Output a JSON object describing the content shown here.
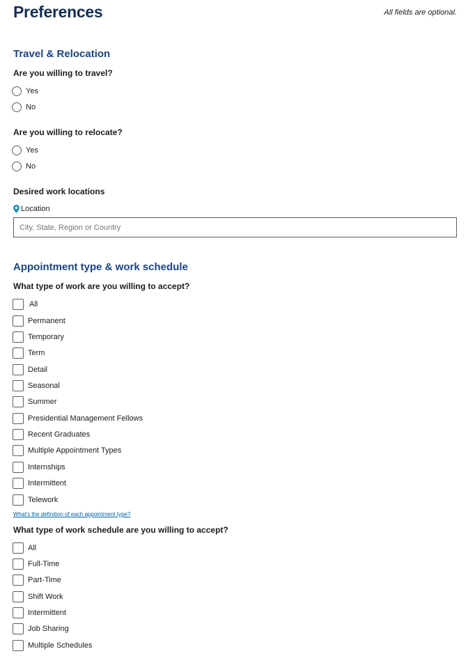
{
  "header": {
    "title": "Preferences",
    "optional_note": "All fields are optional."
  },
  "travel_relocation": {
    "section_title": "Travel & Relocation",
    "travel": {
      "question": "Are you willing to travel?",
      "options": [
        "Yes",
        "No"
      ],
      "selected": null
    },
    "relocate": {
      "question": "Are you willing to relocate?",
      "options": [
        "Yes",
        "No"
      ],
      "selected": null
    },
    "locations": {
      "question": "Desired work locations",
      "field_label": "Location",
      "field_icon": "map-pin-icon",
      "value": "",
      "placeholder": "City, State, Region or Country",
      "icon_color": "#2491bf"
    }
  },
  "appointment": {
    "section_title": "Appointment type & work schedule",
    "work_type": {
      "question": "What type of work are you willing to accept?",
      "options": [
        {
          "label": "All",
          "checked": false
        },
        {
          "label": "Permanent",
          "checked": false
        },
        {
          "label": "Temporary",
          "checked": false
        },
        {
          "label": "Term",
          "checked": false
        },
        {
          "label": "Detail",
          "checked": false
        },
        {
          "label": "Seasonal",
          "checked": false
        },
        {
          "label": "Summer",
          "checked": false
        },
        {
          "label": "Presidential Management Fellows",
          "checked": false
        },
        {
          "label": "Recent Graduates",
          "checked": false
        },
        {
          "label": "Multiple Appointment Types",
          "checked": false
        },
        {
          "label": "Internships",
          "checked": false
        },
        {
          "label": "Intermittent",
          "checked": false
        },
        {
          "label": "Telework",
          "checked": false
        }
      ],
      "definition_link": "What's the definition of each appointment type?"
    },
    "work_schedule": {
      "question": "What type of work schedule are you willing to accept?",
      "options": [
        {
          "label": "All",
          "checked": false
        },
        {
          "label": "Full-Time",
          "checked": false
        },
        {
          "label": "Part-Time",
          "checked": false
        },
        {
          "label": "Shift Work",
          "checked": false
        },
        {
          "label": "Intermittent",
          "checked": false
        },
        {
          "label": "Job Sharing",
          "checked": false
        },
        {
          "label": "Multiple Schedules",
          "checked": false
        }
      ]
    }
  },
  "colors": {
    "title": "#162e51",
    "section_heading": "#1a4480",
    "link": "#005ea2"
  }
}
